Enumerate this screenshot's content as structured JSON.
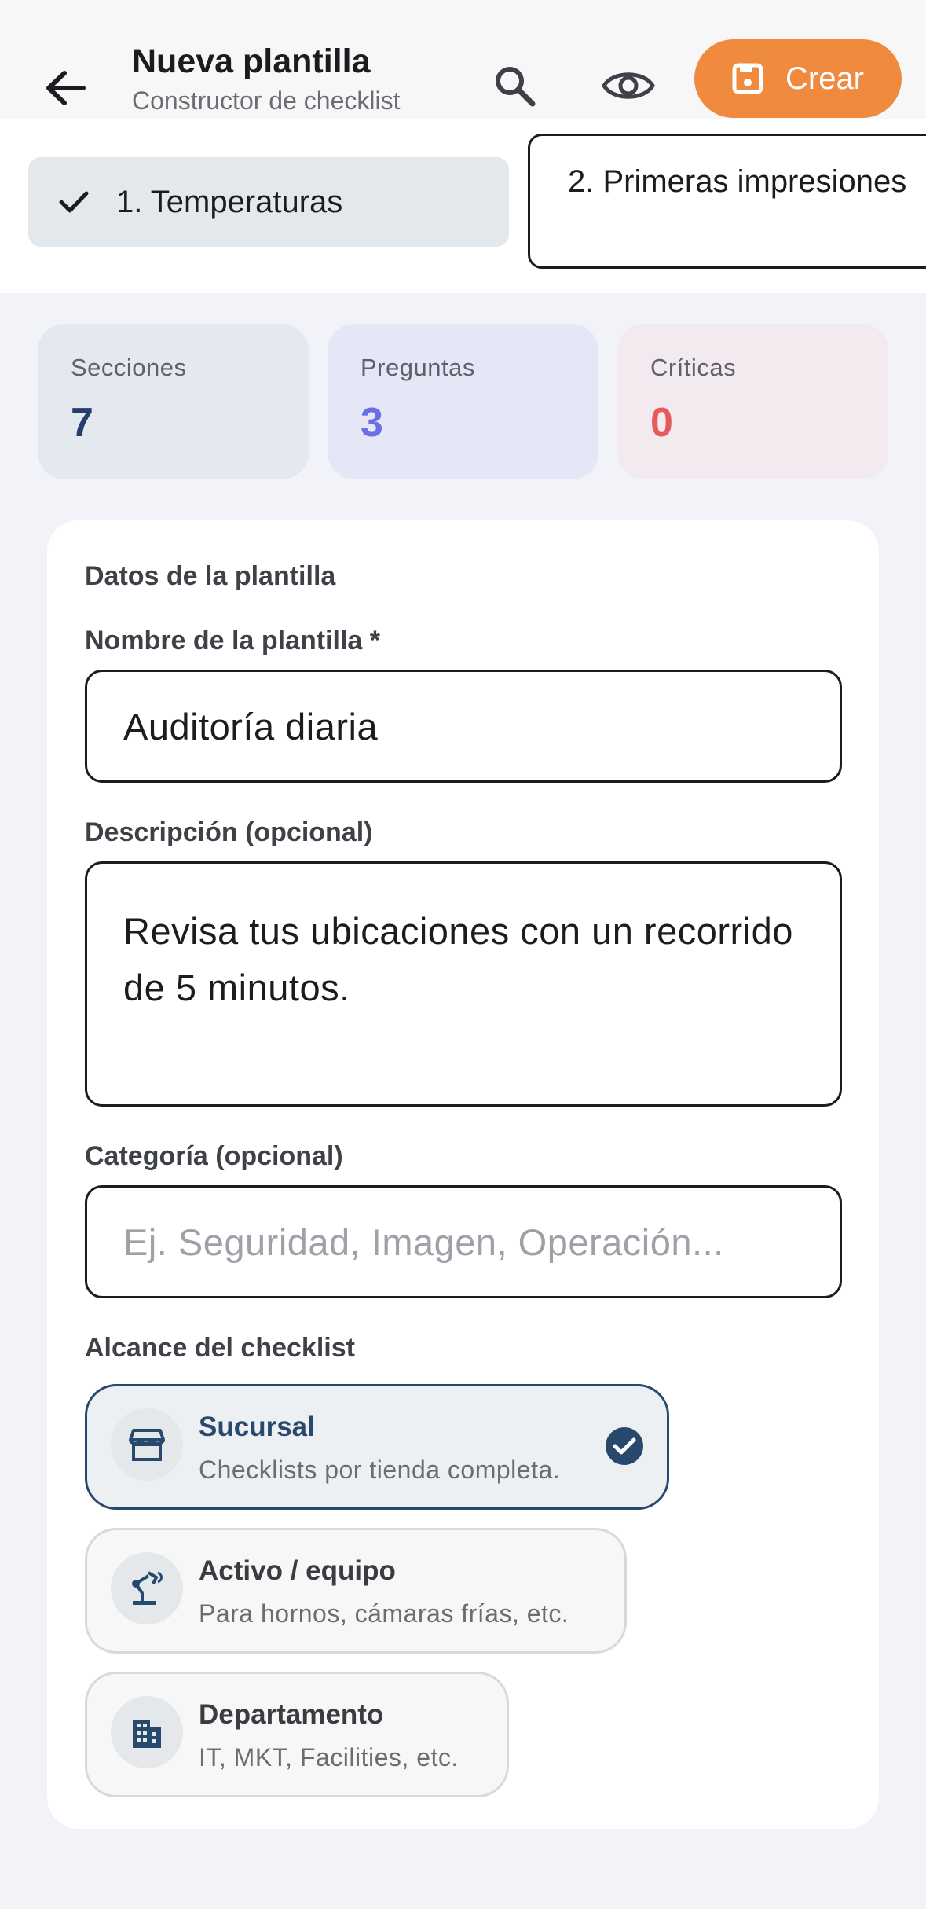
{
  "header": {
    "title": "Nueva plantilla",
    "subtitle": "Constructor de checklist",
    "create_label": "Crear"
  },
  "tabs": [
    {
      "label": "1. Temperaturas",
      "completed": true
    },
    {
      "label": "2. Primeras impresiones",
      "completed": false
    }
  ],
  "stats": [
    {
      "label": "Secciones",
      "value": "7",
      "color": "#233f6c"
    },
    {
      "label": "Preguntas",
      "value": "3",
      "color": "#6a6fe3"
    },
    {
      "label": "Críticas",
      "value": "0",
      "color": "#e55a5a"
    }
  ],
  "form": {
    "section_title": "Datos de la plantilla",
    "name": {
      "label": "Nombre de la plantilla *",
      "value": "Auditoría diaria"
    },
    "description": {
      "label": "Descripción (opcional)",
      "value": "Revisa tus ubicaciones con un recorrido de 5 minutos."
    },
    "category": {
      "label": "Categoría (opcional)",
      "value": "",
      "placeholder": "Ej. Seguridad, Imagen, Operación..."
    },
    "scope": {
      "label": "Alcance del checklist",
      "options": [
        {
          "title": "Sucursal",
          "description": "Checklists por tienda completa.",
          "icon": "storefront-icon",
          "selected": true
        },
        {
          "title": "Activo / equipo",
          "description": "Para hornos, cámaras frías, etc.",
          "icon": "precision-tool-icon",
          "selected": false
        },
        {
          "title": "Departamento",
          "description": "IT, MKT, Facilities, etc.",
          "icon": "building-icon",
          "selected": false
        }
      ]
    }
  },
  "colors": {
    "accent": "#ef8a3e",
    "primary": "#28496e",
    "background": "#f1f3f9"
  }
}
